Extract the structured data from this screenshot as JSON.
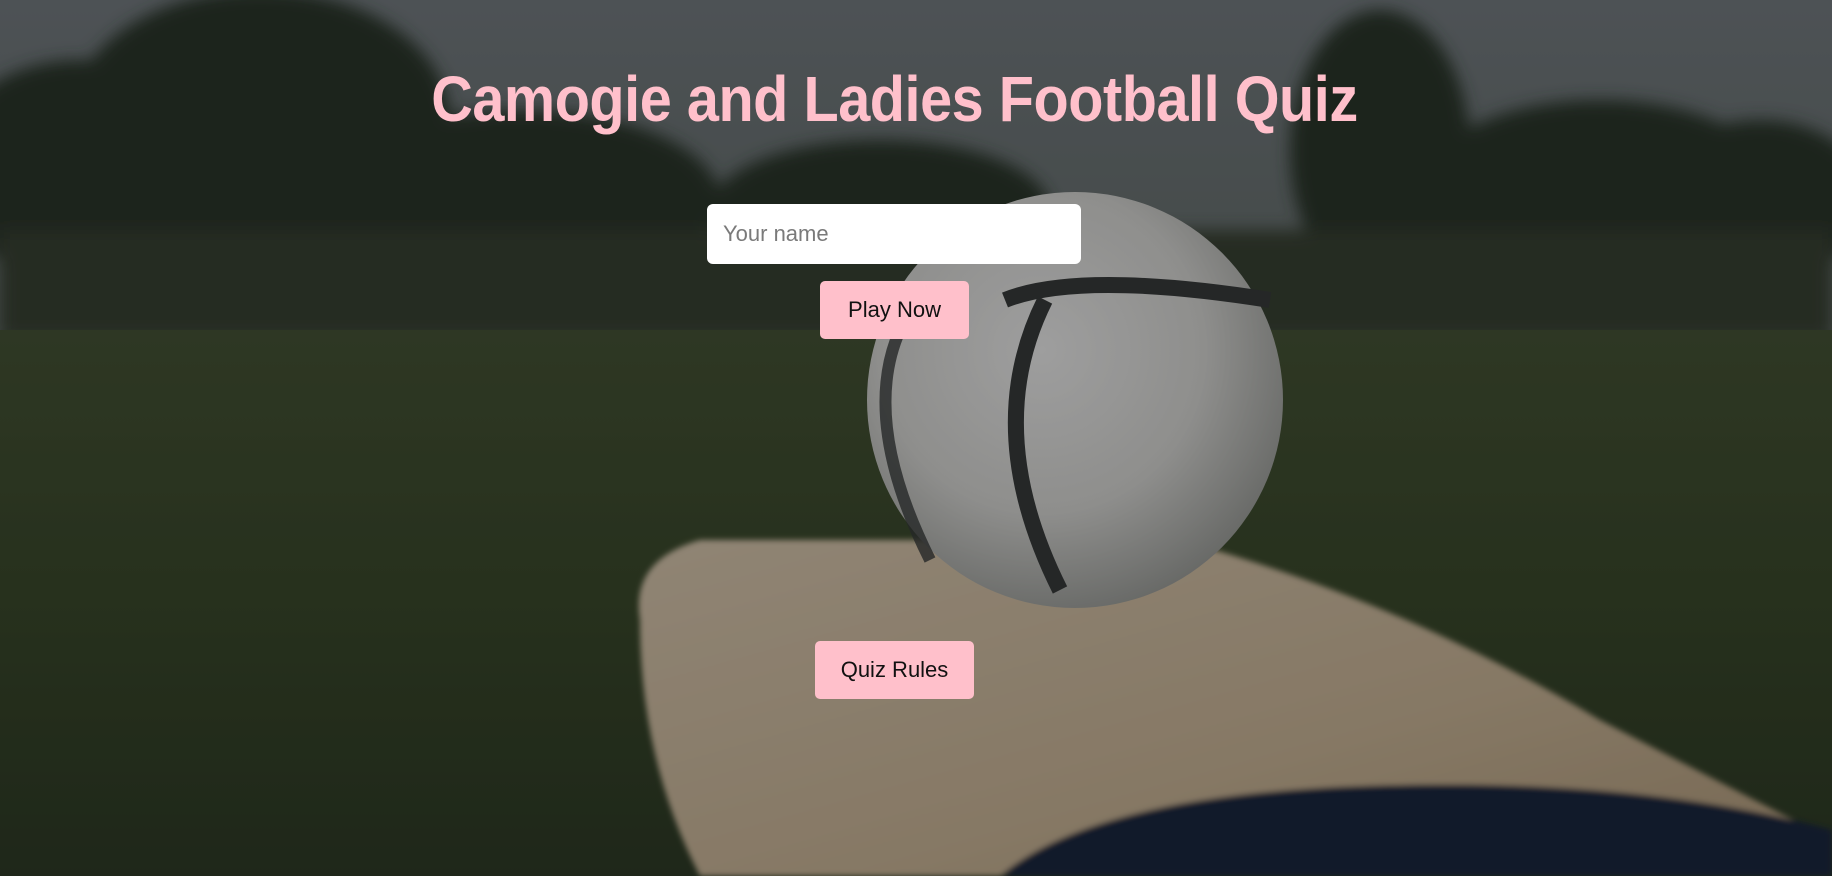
{
  "page": {
    "title": "Camogie and Ladies Football Quiz"
  },
  "name_field": {
    "value": "",
    "placeholder": "Your name"
  },
  "buttons": {
    "play_label": "Play Now",
    "rules_label": "Quiz Rules"
  },
  "colors": {
    "accent": "#ffc0cb",
    "input_bg": "#ffffff"
  },
  "background": {
    "subject": "hurling-ball-on-hurley-photo"
  }
}
